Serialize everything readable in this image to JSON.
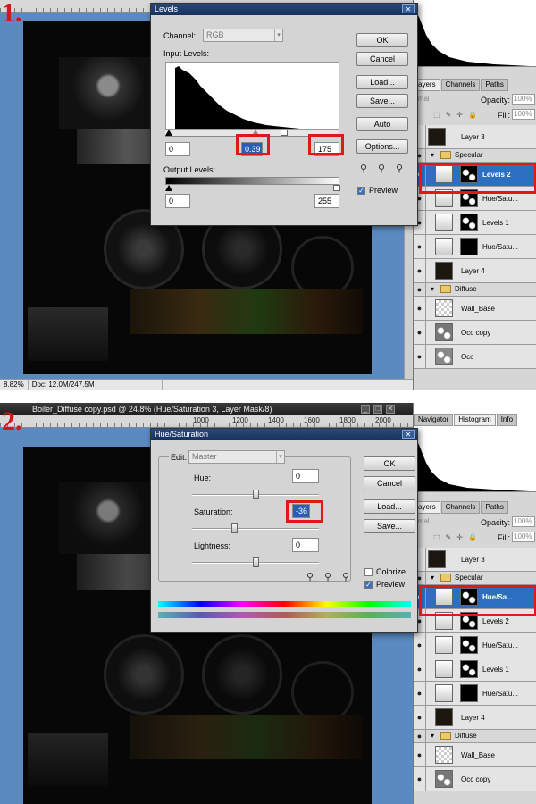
{
  "steps": [
    "1.",
    "2."
  ],
  "panel1": {
    "status": {
      "zoom": "8.82%",
      "doc": "Doc: 12.0M/247.5M"
    },
    "levels_dialog": {
      "title": "Levels",
      "channel_label": "Channel:",
      "channel_value": "RGB",
      "input_levels_label": "Input Levels:",
      "input_black": "0",
      "input_gamma": "0.39",
      "input_white": "175",
      "output_levels_label": "Output Levels:",
      "output_black": "0",
      "output_white": "255",
      "buttons": [
        "OK",
        "Cancel",
        "Load...",
        "Save...",
        "Auto",
        "Options..."
      ],
      "preview_label": "Preview",
      "preview_checked": true
    },
    "layers_panel": {
      "tabs": [
        "ayers",
        "Channels",
        "Paths"
      ],
      "opacity_label": "Opacity:",
      "opacity_value": "100%",
      "fill_label": "Fill:",
      "fill_value": "100%",
      "blend_mode": "rmal",
      "layers": [
        {
          "name": "Layer 3",
          "kind": "pixel"
        },
        {
          "name": "Specular",
          "kind": "group"
        },
        {
          "name": "Levels 2",
          "kind": "adjustment",
          "selected": true
        },
        {
          "name": "Hue/Satu...",
          "kind": "adjustment"
        },
        {
          "name": "Levels 1",
          "kind": "adjustment"
        },
        {
          "name": "Hue/Satu...",
          "kind": "adjustment"
        },
        {
          "name": "Layer 4",
          "kind": "pixel"
        },
        {
          "name": "Diffuse",
          "kind": "group"
        },
        {
          "name": "Wall_Base",
          "kind": "pixel"
        },
        {
          "name": "Occ copy",
          "kind": "pixel"
        },
        {
          "name": "Occ",
          "kind": "pixel"
        }
      ]
    }
  },
  "panel2": {
    "doc_title": "Boiler_Diffuse copy.psd @ 24.8% (Hue/Saturation 3, Layer Mask/8)",
    "ruler_ticks": [
      "1000",
      "1200",
      "1400",
      "1600",
      "1800",
      "2000"
    ],
    "nav_tabs": [
      "Navigator",
      "Histogram",
      "Info"
    ],
    "hue_sat_dialog": {
      "title": "Hue/Saturation",
      "edit_label": "Edit:",
      "edit_value": "Master",
      "hue_label": "Hue:",
      "hue_value": "0",
      "saturation_label": "Saturation:",
      "saturation_value": "-36",
      "lightness_label": "Lightness:",
      "lightness_value": "0",
      "buttons": [
        "OK",
        "Cancel",
        "Load...",
        "Save..."
      ],
      "colorize_label": "Colorize",
      "colorize_checked": false,
      "preview_label": "Preview",
      "preview_checked": true
    },
    "layers_panel": {
      "tabs": [
        "ayers",
        "Channels",
        "Paths"
      ],
      "opacity_label": "Opacity:",
      "opacity_value": "100%",
      "fill_label": "Fill:",
      "fill_value": "100%",
      "blend_mode": "rmal",
      "layers": [
        {
          "name": "Layer 3",
          "kind": "pixel"
        },
        {
          "name": "Specular",
          "kind": "group"
        },
        {
          "name": "Hue/Sa...",
          "kind": "adjustment",
          "selected": true
        },
        {
          "name": "Levels 2",
          "kind": "adjustment"
        },
        {
          "name": "Hue/Satu...",
          "kind": "adjustment"
        },
        {
          "name": "Levels 1",
          "kind": "adjustment"
        },
        {
          "name": "Hue/Satu...",
          "kind": "adjustment"
        },
        {
          "name": "Layer 4",
          "kind": "pixel"
        },
        {
          "name": "Diffuse",
          "kind": "group"
        },
        {
          "name": "Wall_Base",
          "kind": "pixel"
        },
        {
          "name": "Occ copy",
          "kind": "pixel"
        }
      ]
    }
  },
  "colors": {
    "highlight": "#e01818",
    "selection": "#2a6fc0",
    "canvas_bg": "#5a8ac0"
  }
}
